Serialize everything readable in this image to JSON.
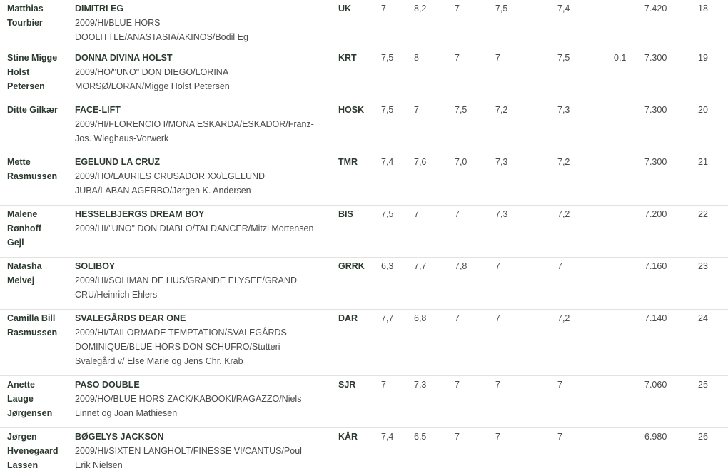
{
  "rows": [
    {
      "rider": [
        "Matthias",
        "Tourbier"
      ],
      "horse_name": "DIMITRI EG",
      "horse_info": [
        "2009/HI/BLUE HORS",
        "DOOLITTLE/ANASTASIA/AKINOS/Bodil Eg"
      ],
      "club": "UK",
      "scores": [
        "7",
        "8,2",
        "7",
        "7,5",
        "7,4",
        ""
      ],
      "total": "7.420",
      "place": "18"
    },
    {
      "rider": [
        "Stine Migge",
        "Holst",
        "Petersen"
      ],
      "horse_name": "DONNA DIVINA HOLST",
      "horse_info": [
        "2009/HO/\"UNO\" DON DIEGO/LORINA",
        "MORSØ/LORAN/Migge Holst Petersen"
      ],
      "club": "KRT",
      "scores": [
        "7,5",
        "8",
        "7",
        "7",
        "7,5",
        "0,1"
      ],
      "total": "7.300",
      "place": "19"
    },
    {
      "rider": [
        "Ditte Gilkær"
      ],
      "horse_name": "FACE-LIFT",
      "horse_info": [
        "2009/HI/FLORENCIO I/MONA ESKARDA/ESKADOR/Franz-",
        "Jos. Wieghaus-Vorwerk"
      ],
      "club": "HOSK",
      "scores": [
        "7,5",
        "7",
        "7,5",
        "7,2",
        "7,3",
        ""
      ],
      "total": "7.300",
      "place": "20"
    },
    {
      "rider": [
        "Mette",
        "Rasmussen"
      ],
      "horse_name": "EGELUND LA CRUZ",
      "horse_info": [
        "2009/HO/LAURIES CRUSADOR XX/EGELUND",
        "JUBA/LABAN AGERBO/Jørgen K. Andersen"
      ],
      "club": "TMR",
      "scores": [
        "7,4",
        "7,6",
        "7,0",
        "7,3",
        "7,2",
        ""
      ],
      "total": "7.300",
      "place": "21"
    },
    {
      "rider": [
        "Malene",
        "Rønhoff",
        "Gejl"
      ],
      "horse_name": "HESSELBJERGS DREAM BOY",
      "horse_info": [
        "2009/HI/\"UNO\" DON DIABLO/TAI DANCER/Mitzi Mortensen"
      ],
      "club": "BIS",
      "scores": [
        "7,5",
        "7",
        "7",
        "7,3",
        "7,2",
        ""
      ],
      "total": "7.200",
      "place": "22"
    },
    {
      "rider": [
        "Natasha",
        "Melvej"
      ],
      "horse_name": "SOLIBOY",
      "horse_info": [
        "2009/HI/SOLIMAN DE HUS/GRANDE ELYSEE/GRAND",
        "CRU/Heinrich Ehlers"
      ],
      "club": "GRRK",
      "scores": [
        "6,3",
        "7,7",
        "7,8",
        "7",
        "7",
        ""
      ],
      "total": "7.160",
      "place": "23"
    },
    {
      "rider": [
        "Camilla Bill",
        "Rasmussen"
      ],
      "horse_name": "SVALEGÅRDS DEAR ONE",
      "horse_info": [
        "2009/HI/TAILORMADE TEMPTATION/SVALEGÅRDS",
        "DOMINIQUE/BLUE HORS DON SCHUFRO/Stutteri",
        "Svalegård v/ Else Marie og Jens Chr. Krab"
      ],
      "club": "DAR",
      "scores": [
        "7,7",
        "6,8",
        "7",
        "7",
        "7,2",
        ""
      ],
      "total": "7.140",
      "place": "24"
    },
    {
      "rider": [
        "Anette",
        "Lauge",
        "Jørgensen"
      ],
      "horse_name": "PASO DOUBLE",
      "horse_info": [
        "2009/HO/BLUE HORS ZACK/KABOOKI/RAGAZZO/Niels",
        "Linnet og Joan Mathiesen"
      ],
      "club": "SJR",
      "scores": [
        "7",
        "7,3",
        "7",
        "7",
        "7",
        ""
      ],
      "total": "7.060",
      "place": "25"
    },
    {
      "rider": [
        "Jørgen",
        "Hvenegaard",
        "Lassen"
      ],
      "horse_name": "BØGELYS JACKSON",
      "horse_info": [
        "2009/HI/SIXTEN LANGHOLT/FINESSE VI/CANTUS/Poul",
        "Erik Nielsen"
      ],
      "club": "KÅR",
      "scores": [
        "7,4",
        "6,5",
        "7",
        "7",
        "7",
        ""
      ],
      "total": "6.980",
      "place": "26"
    }
  ]
}
